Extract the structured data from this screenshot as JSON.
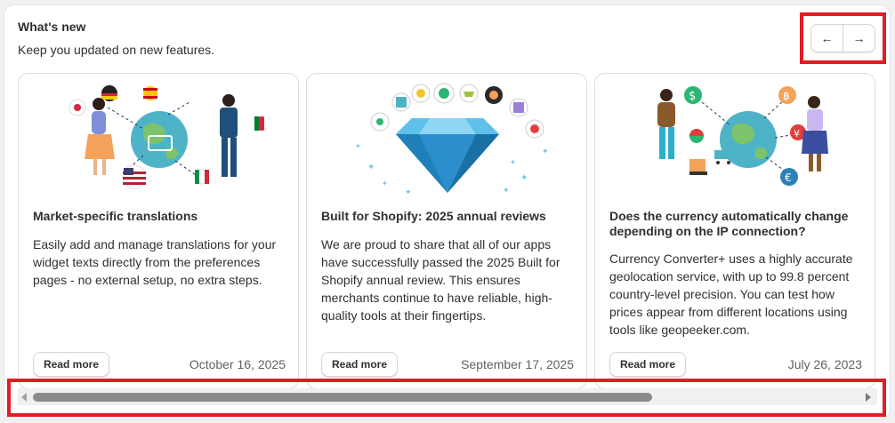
{
  "header": {
    "title": "What's new",
    "subtitle": "Keep you updated on new features."
  },
  "nav": {
    "prev_icon": "←",
    "next_icon": "→"
  },
  "cards": [
    {
      "title": "Market-specific translations",
      "body": "Easily add and manage translations for your widget texts directly from the preferences pages - no external setup, no extra steps.",
      "read_more": "Read more",
      "date": "October 16, 2025",
      "illustration": "people-with-language-flags-globe"
    },
    {
      "title": "Built for Shopify: 2025 annual reviews",
      "body": "We are proud to share that all of our apps have successfully passed the 2025 Built for Shopify annual review. This ensures merchants continue to have reliable, high-quality tools at their fingertips.",
      "read_more": "Read more",
      "date": "September 17, 2025",
      "illustration": "diamond-with-app-icons"
    },
    {
      "title": "Does the currency automatically change depending on the IP connection?",
      "body": "Currency Converter+ uses a highly accurate geolocation service, with up to 99.8 percent country-level precision. You can test how prices appear from different locations using tools like geopeeker.com.",
      "read_more": "Read more",
      "date": "July 26, 2023",
      "illustration": "people-with-currency-symbols-globe"
    }
  ],
  "colors": {
    "highlight": "#e31b23",
    "diamond": "#2f9fd6",
    "globe": "#4fb3c8"
  }
}
